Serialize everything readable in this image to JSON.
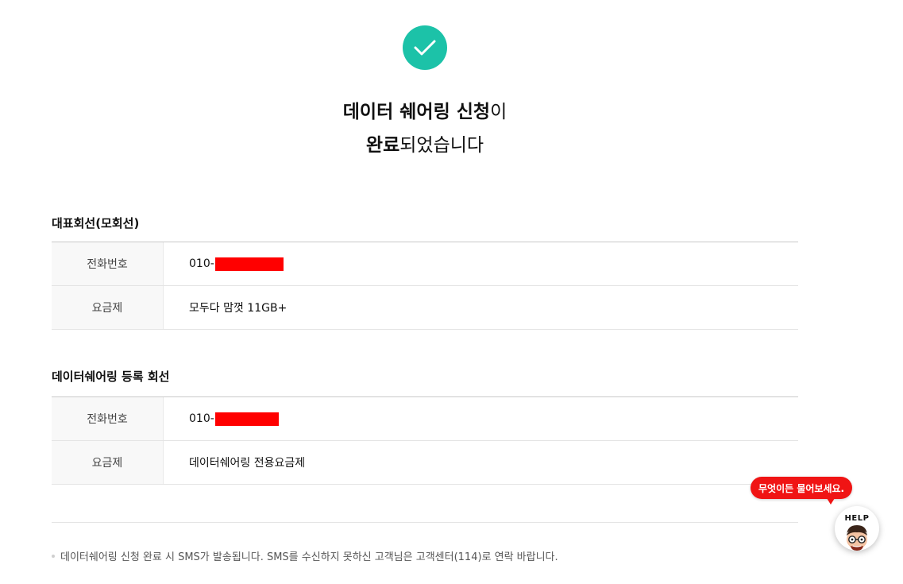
{
  "header": {
    "title_line1_bold": "데이터 쉐어링 신청",
    "title_line1_rest": "이",
    "title_line2_bold": "완료",
    "title_line2_rest": "되었습니다"
  },
  "representative_line": {
    "section_title": "대표회선(모회선)",
    "rows": [
      {
        "label": "전화번호",
        "value": "010-"
      },
      {
        "label": "요금제",
        "value": "모두다 맘껏 11GB+"
      }
    ]
  },
  "sharing_line": {
    "section_title": "데이터쉐어링 등록 회선",
    "rows": [
      {
        "label": "전화번호",
        "value": "010-"
      },
      {
        "label": "요금제",
        "value": "데이터쉐어링 전용요금제"
      }
    ]
  },
  "notice": "데이터쉐어링 신청 완료 시 SMS가 발송됩니다. SMS를 수신하지 못하신 고객님은 고객센터(114)로 연락 바랍니다.",
  "help": {
    "bubble_text": "무엇이든 물어보세요.",
    "button_label": "HELP"
  },
  "colors": {
    "accent": "#1cc2a8",
    "help_red": "#f01414",
    "redaction": "#ff0000"
  },
  "icons": [
    "check-icon",
    "help-character-icon"
  ]
}
